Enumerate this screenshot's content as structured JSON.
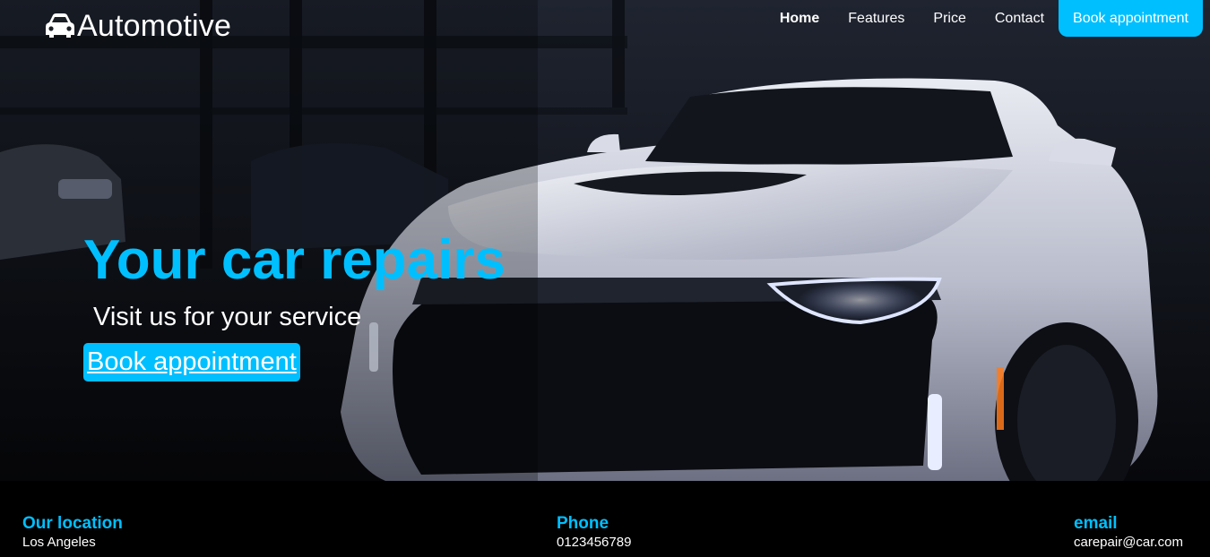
{
  "brand": {
    "icon": "car-icon",
    "name": "Automotive"
  },
  "nav": {
    "items": [
      {
        "label": "Home",
        "active": true
      },
      {
        "label": "Features",
        "active": false
      },
      {
        "label": "Price",
        "active": false
      },
      {
        "label": "Contact",
        "active": false
      }
    ],
    "cta_label": "Book appointment"
  },
  "hero": {
    "title": "Your car repairs",
    "subtitle": "Visit us for your service",
    "cta_label": "Book appointment",
    "image": "white-sports-car-in-garage"
  },
  "footer": {
    "location": {
      "label": "Our location",
      "value": "Los Angeles"
    },
    "phone": {
      "label": "Phone",
      "value": "0123456789"
    },
    "email": {
      "label": "email",
      "value": "carepair@car.com"
    }
  },
  "colors": {
    "accent": "#00bfff",
    "background": "#000000",
    "text": "#ffffff"
  }
}
